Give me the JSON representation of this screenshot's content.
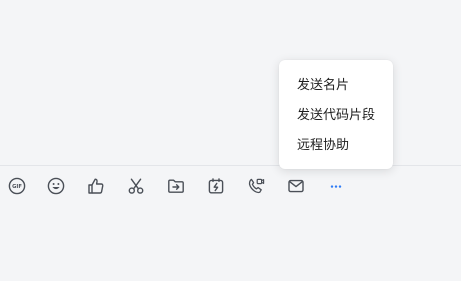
{
  "popup_menu": {
    "items": [
      {
        "label": "发送名片"
      },
      {
        "label": "发送代码片段"
      },
      {
        "label": "远程协助"
      }
    ]
  },
  "toolbar": {
    "gif_label": "GIF",
    "icons": [
      "gif-icon",
      "emoji-icon",
      "thumbs-up-icon",
      "scissors-icon",
      "folder-send-icon",
      "flash-icon",
      "video-call-icon",
      "mail-icon",
      "more-icon"
    ]
  },
  "colors": {
    "background": "#f4f5f7",
    "icon": "#4a4f57",
    "accent": "#2f7cf6",
    "menu_background": "#ffffff"
  }
}
